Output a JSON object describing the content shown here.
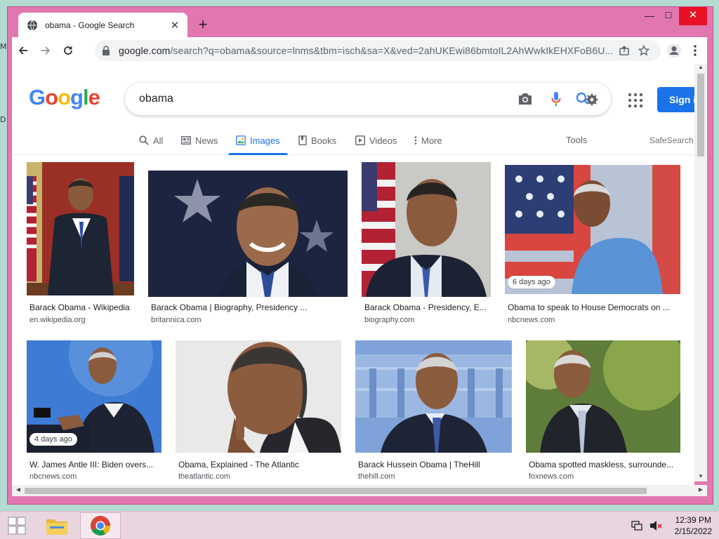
{
  "desktop": {
    "edge_letter_1": "M",
    "edge_letter_2": "D"
  },
  "browser": {
    "tab_title": "obama - Google Search",
    "url_host": "google.com",
    "url_path": "/search?q=obama&source=lnms&tbm=isch&sa=X&ved=2ahUKEwi86bmtoIL2AhWwkIkEHXFoB6U..."
  },
  "google": {
    "logo_letters": [
      "G",
      "o",
      "o",
      "g",
      "l",
      "e"
    ],
    "logo_colors": [
      "#4285f4",
      "#ea4335",
      "#fbbc05",
      "#4285f4",
      "#34a853",
      "#ea4335"
    ],
    "query": "obama",
    "signin_label": "Sign in",
    "tabs": [
      {
        "label": "All",
        "icon": "search-icon"
      },
      {
        "label": "News",
        "icon": "news-icon"
      },
      {
        "label": "Images",
        "icon": "images-icon",
        "active": true
      },
      {
        "label": "Books",
        "icon": "book-icon"
      },
      {
        "label": "Videos",
        "icon": "video-icon"
      },
      {
        "label": "More",
        "icon": "more-vert-icon"
      }
    ],
    "tools_label": "Tools",
    "safesearch_label": "SafeSearch"
  },
  "results": [
    {
      "caption": "Barack Obama - Wikipedia",
      "source": "en.wikipedia.org",
      "badge": ""
    },
    {
      "caption": "Barack Obama | Biography, Presidency ...",
      "source": "britannica.com",
      "badge": ""
    },
    {
      "caption": "Barack Obama - Presidency, E...",
      "source": "biography.com",
      "badge": ""
    },
    {
      "caption": "Obama to speak to House Democrats on ...",
      "source": "nbcnews.com",
      "badge": "6 days ago"
    },
    {
      "caption": "W. James Antle III: Biden overs...",
      "source": "nbcnews.com",
      "badge": "4 days ago"
    },
    {
      "caption": "Obama, Explained - The Atlantic",
      "source": "theatlantic.com",
      "badge": ""
    },
    {
      "caption": "Barack Hussein Obama | TheHill",
      "source": "thehill.com",
      "badge": ""
    },
    {
      "caption": "Obama spotted maskless, surrounde...",
      "source": "foxnews.com",
      "badge": ""
    }
  ],
  "taskbar": {
    "time": "12:39 PM",
    "date": "2/15/2022"
  },
  "colors": {
    "accent": "#1a73e8",
    "window_frame": "#e277b0",
    "taskbar": "#e8d5e0"
  }
}
